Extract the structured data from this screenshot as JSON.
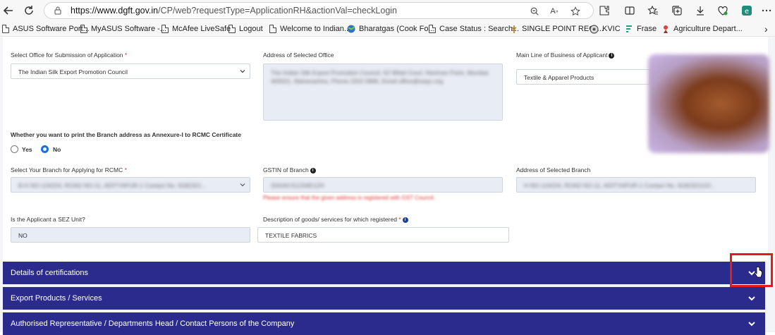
{
  "browser": {
    "url_prefix": "https://www.dgft.gov.in",
    "url_rest": "/CP/web?requestType=ApplicationRH&actionVal=checkLogin",
    "bookmarks": [
      {
        "label": "ASUS Software Port...",
        "icon": "doc-icon"
      },
      {
        "label": "MyASUS Software -...",
        "icon": "doc-icon"
      },
      {
        "label": "McAfee LiveSafe",
        "icon": "doc-icon"
      },
      {
        "label": "Logout",
        "icon": "doc-icon"
      },
      {
        "label": "Welcome to Indian...",
        "icon": "doc-icon"
      },
      {
        "label": "Bharatgas (Cook Fo...",
        "icon": "globe-icon"
      },
      {
        "label": "Case Status : Search...",
        "icon": "doc-icon"
      },
      {
        "label": "SINGLE POINT REGI...",
        "icon": "emblem-icon"
      },
      {
        "label": "KVIC",
        "icon": "kvic-icon"
      },
      {
        "label": "Frase",
        "icon": "frase-icon"
      },
      {
        "label": "Agriculture Depart...",
        "icon": "emblem-icon"
      }
    ]
  },
  "form": {
    "office_label": "Select Office for Submission of Application",
    "office_value": "The Indian Silk Export Promotion Council",
    "address_office_label": "Address of Selected Office",
    "address_office_value": "The Indian Silk Export Promotion Council, 62 Mittal Court, Nariman Point, Mumbai 400021, Maharashtra, Phone 2202 5866, Email office@isepc.org",
    "business_label": "Main Line of Business of Applicant",
    "business_value": "Textile & Apparel Products",
    "print_branch_label": "Whether you want to print the Branch address as Annexure-I to RCMC Certificate",
    "radio_yes": "Yes",
    "radio_no": "No",
    "branch_label": "Select Your Branch for Applying for RCMC",
    "branch_value": "B-H NO-124/2/4, ROAD NO-11, ADITYAPUR-1 Contact No. 9182321...",
    "gstin_label": "GSTIN of Branch",
    "gstin_value": "20AAICS1234E1ZH",
    "gstin_error": "Please ensure that the given address is registered with GST Council.",
    "branch_address_label": "Address of Selected Branch",
    "branch_address_value": "H NO-124/2/4, ROAD NO-11, ADITYAPUR-1 Contact No. 9182321122...",
    "sez_label": "Is the Applicant a SEZ Unit?",
    "sez_value": "NO",
    "goods_label": "Description of goods/ services for which registered",
    "goods_value": "TEXTILE FABRICS"
  },
  "accordions": [
    {
      "title": "Details of certifications"
    },
    {
      "title": "Export Products / Services"
    },
    {
      "title": "Authorised Representative / Departments Head / Contact Persons of the Company"
    }
  ]
}
